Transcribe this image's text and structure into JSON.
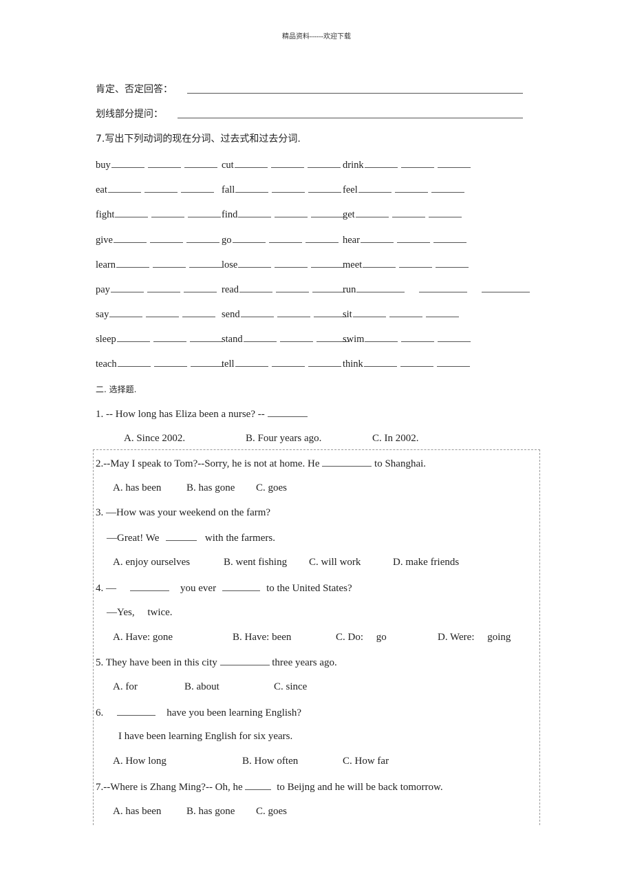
{
  "header": {
    "text": "精品资料------欢迎下载"
  },
  "answer_lines": {
    "positive_negative_label": "肯定、否定回答：",
    "underline_question_label": "划线部分提问："
  },
  "section7": {
    "title": "7.写出下列动词的现在分词、过去式和过去分词.",
    "rows": [
      [
        "buy",
        "cut",
        "drink"
      ],
      [
        "eat",
        "fall",
        "feel"
      ],
      [
        "fight",
        "find",
        "get"
      ],
      [
        "give",
        "go",
        "hear"
      ],
      [
        "learn",
        "lose",
        "meet"
      ],
      [
        "pay",
        "read",
        "run"
      ],
      [
        "say",
        "send",
        "sit"
      ],
      [
        "sleep",
        "stand",
        "swim"
      ],
      [
        "teach",
        "tell",
        "think"
      ]
    ]
  },
  "section2": {
    "title": "二.  选择题.",
    "questions": [
      {
        "num": "1.",
        "lines": [
          "1. -- How long has Eliza been a nurse?    -- "
        ],
        "options": [
          "A. Since 2002.",
          "B. Four years ago.",
          "C. In 2002."
        ]
      },
      {
        "num": "2.",
        "line1_pre": "2.--May I speak to Tom?--Sorry, he is not at home. He ",
        "line1_post": " to Shanghai.",
        "options": [
          "A. has been",
          "B. has gone",
          "C. goes"
        ]
      },
      {
        "num": "3.",
        "line1": "3. —How was your weekend on the farm?",
        "line2_pre": "—Great!    We ",
        "line2_post": " with the farmers.",
        "options": [
          "A. enjoy ourselves",
          "B. went fishing",
          "C. will work",
          "D. make friends"
        ]
      },
      {
        "num": "4.",
        "line1_a": "4. —",
        "line1_b": "you ever",
        "line1_c": "to the United States?",
        "line2": "—Yes,     twice.",
        "options": [
          "A. Have: gone",
          "B. Have: been",
          "C. Do:     go",
          "D. Were:     going"
        ]
      },
      {
        "num": "5.",
        "line1_pre": "5. They have been in this city ",
        "line1_post": " three years ago.",
        "options": [
          "A. for",
          "B. about",
          "C. since"
        ]
      },
      {
        "num": "6.",
        "line1_a": "6.",
        "line1_b": "have you been learning English?",
        "line2": "I have been learning English for six years.",
        "options": [
          "A. How long",
          "B. How often",
          "C. How far"
        ]
      },
      {
        "num": "7.",
        "line1_pre": "7.--Where is Zhang Ming?-- Oh, he ",
        "line1_post": " to Beijng and he will be back tomorrow.",
        "options": [
          "A. has been",
          "B. has gone",
          "C. goes"
        ]
      }
    ]
  }
}
